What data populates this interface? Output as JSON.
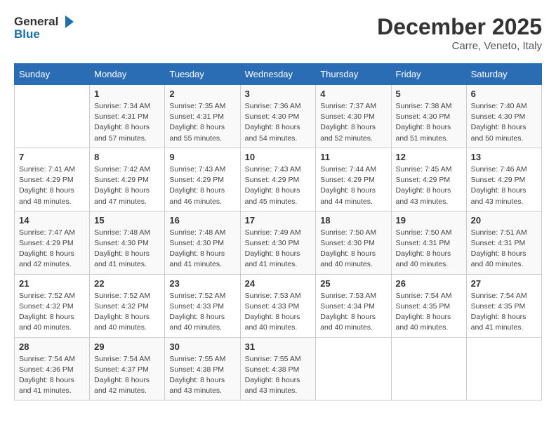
{
  "logo": {
    "text_general": "General",
    "text_blue": "Blue"
  },
  "title": "December 2025",
  "subtitle": "Carre, Veneto, Italy",
  "days_of_week": [
    "Sunday",
    "Monday",
    "Tuesday",
    "Wednesday",
    "Thursday",
    "Friday",
    "Saturday"
  ],
  "weeks": [
    [
      {
        "day": "",
        "info": ""
      },
      {
        "day": "1",
        "info": "Sunrise: 7:34 AM\nSunset: 4:31 PM\nDaylight: 8 hours\nand 57 minutes."
      },
      {
        "day": "2",
        "info": "Sunrise: 7:35 AM\nSunset: 4:31 PM\nDaylight: 8 hours\nand 55 minutes."
      },
      {
        "day": "3",
        "info": "Sunrise: 7:36 AM\nSunset: 4:30 PM\nDaylight: 8 hours\nand 54 minutes."
      },
      {
        "day": "4",
        "info": "Sunrise: 7:37 AM\nSunset: 4:30 PM\nDaylight: 8 hours\nand 52 minutes."
      },
      {
        "day": "5",
        "info": "Sunrise: 7:38 AM\nSunset: 4:30 PM\nDaylight: 8 hours\nand 51 minutes."
      },
      {
        "day": "6",
        "info": "Sunrise: 7:40 AM\nSunset: 4:30 PM\nDaylight: 8 hours\nand 50 minutes."
      }
    ],
    [
      {
        "day": "7",
        "info": "Sunrise: 7:41 AM\nSunset: 4:29 PM\nDaylight: 8 hours\nand 48 minutes."
      },
      {
        "day": "8",
        "info": "Sunrise: 7:42 AM\nSunset: 4:29 PM\nDaylight: 8 hours\nand 47 minutes."
      },
      {
        "day": "9",
        "info": "Sunrise: 7:43 AM\nSunset: 4:29 PM\nDaylight: 8 hours\nand 46 minutes."
      },
      {
        "day": "10",
        "info": "Sunrise: 7:43 AM\nSunset: 4:29 PM\nDaylight: 8 hours\nand 45 minutes."
      },
      {
        "day": "11",
        "info": "Sunrise: 7:44 AM\nSunset: 4:29 PM\nDaylight: 8 hours\nand 44 minutes."
      },
      {
        "day": "12",
        "info": "Sunrise: 7:45 AM\nSunset: 4:29 PM\nDaylight: 8 hours\nand 43 minutes."
      },
      {
        "day": "13",
        "info": "Sunrise: 7:46 AM\nSunset: 4:29 PM\nDaylight: 8 hours\nand 43 minutes."
      }
    ],
    [
      {
        "day": "14",
        "info": "Sunrise: 7:47 AM\nSunset: 4:29 PM\nDaylight: 8 hours\nand 42 minutes."
      },
      {
        "day": "15",
        "info": "Sunrise: 7:48 AM\nSunset: 4:30 PM\nDaylight: 8 hours\nand 41 minutes."
      },
      {
        "day": "16",
        "info": "Sunrise: 7:48 AM\nSunset: 4:30 PM\nDaylight: 8 hours\nand 41 minutes."
      },
      {
        "day": "17",
        "info": "Sunrise: 7:49 AM\nSunset: 4:30 PM\nDaylight: 8 hours\nand 41 minutes."
      },
      {
        "day": "18",
        "info": "Sunrise: 7:50 AM\nSunset: 4:30 PM\nDaylight: 8 hours\nand 40 minutes."
      },
      {
        "day": "19",
        "info": "Sunrise: 7:50 AM\nSunset: 4:31 PM\nDaylight: 8 hours\nand 40 minutes."
      },
      {
        "day": "20",
        "info": "Sunrise: 7:51 AM\nSunset: 4:31 PM\nDaylight: 8 hours\nand 40 minutes."
      }
    ],
    [
      {
        "day": "21",
        "info": "Sunrise: 7:52 AM\nSunset: 4:32 PM\nDaylight: 8 hours\nand 40 minutes."
      },
      {
        "day": "22",
        "info": "Sunrise: 7:52 AM\nSunset: 4:32 PM\nDaylight: 8 hours\nand 40 minutes."
      },
      {
        "day": "23",
        "info": "Sunrise: 7:52 AM\nSunset: 4:33 PM\nDaylight: 8 hours\nand 40 minutes."
      },
      {
        "day": "24",
        "info": "Sunrise: 7:53 AM\nSunset: 4:33 PM\nDaylight: 8 hours\nand 40 minutes."
      },
      {
        "day": "25",
        "info": "Sunrise: 7:53 AM\nSunset: 4:34 PM\nDaylight: 8 hours\nand 40 minutes."
      },
      {
        "day": "26",
        "info": "Sunrise: 7:54 AM\nSunset: 4:35 PM\nDaylight: 8 hours\nand 40 minutes."
      },
      {
        "day": "27",
        "info": "Sunrise: 7:54 AM\nSunset: 4:35 PM\nDaylight: 8 hours\nand 41 minutes."
      }
    ],
    [
      {
        "day": "28",
        "info": "Sunrise: 7:54 AM\nSunset: 4:36 PM\nDaylight: 8 hours\nand 41 minutes."
      },
      {
        "day": "29",
        "info": "Sunrise: 7:54 AM\nSunset: 4:37 PM\nDaylight: 8 hours\nand 42 minutes."
      },
      {
        "day": "30",
        "info": "Sunrise: 7:55 AM\nSunset: 4:38 PM\nDaylight: 8 hours\nand 43 minutes."
      },
      {
        "day": "31",
        "info": "Sunrise: 7:55 AM\nSunset: 4:38 PM\nDaylight: 8 hours\nand 43 minutes."
      },
      {
        "day": "",
        "info": ""
      },
      {
        "day": "",
        "info": ""
      },
      {
        "day": "",
        "info": ""
      }
    ]
  ]
}
